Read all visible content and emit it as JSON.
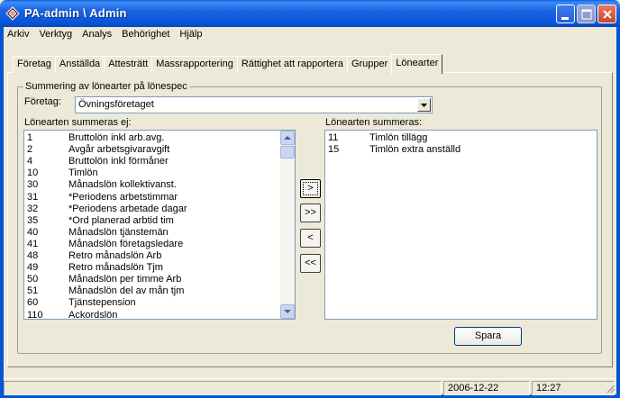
{
  "window": {
    "title": "PA-admin \\ Admin"
  },
  "menu": {
    "items": [
      "Arkiv",
      "Verktyg",
      "Analys",
      "Behörighet",
      "Hjälp"
    ]
  },
  "tabs": [
    {
      "label": "Företag",
      "active": false
    },
    {
      "label": "Anställda",
      "active": false
    },
    {
      "label": "Attesträtt",
      "active": false
    },
    {
      "label": "Massrapportering",
      "active": false
    },
    {
      "label": "Rättighet att rapportera",
      "active": false
    },
    {
      "label": "Grupper",
      "active": false
    },
    {
      "label": "Lönearter",
      "active": true
    }
  ],
  "group": {
    "title": "Summering av lönearter på lönespec",
    "company_label": "Företag:",
    "company_value": "Övningsföretaget",
    "left_label": "Lönearten summeras ej:",
    "right_label": "Lönearten summeras:"
  },
  "left_list": [
    {
      "code": "1",
      "name": "Bruttolön inkl arb.avg."
    },
    {
      "code": "2",
      "name": "Avgår arbetsgivaravgift"
    },
    {
      "code": "4",
      "name": "Bruttolön inkl förmåner"
    },
    {
      "code": "10",
      "name": "Timlön"
    },
    {
      "code": "30",
      "name": "Månadslön kollektivanst."
    },
    {
      "code": "31",
      "name": "*Periodens arbetstimmar"
    },
    {
      "code": "32",
      "name": "*Periodens arbetade dagar"
    },
    {
      "code": "35",
      "name": "*Ord planerad arbtid tim"
    },
    {
      "code": "40",
      "name": "Månadslön tjänstemän"
    },
    {
      "code": "41",
      "name": "Månadslön företagsledare"
    },
    {
      "code": "48",
      "name": "Retro månadslön Arb"
    },
    {
      "code": "49",
      "name": "Retro månadslön Tjm"
    },
    {
      "code": "50",
      "name": "Månadslön per timme Arb"
    },
    {
      "code": "51",
      "name": "Månadslön del av mån tjm"
    },
    {
      "code": "60",
      "name": "Tjänstepension"
    },
    {
      "code": "110",
      "name": "Ackordslön"
    }
  ],
  "right_list": [
    {
      "code": "11",
      "name": "Timlön tillägg"
    },
    {
      "code": "15",
      "name": "Timlön extra anställd"
    }
  ],
  "move_buttons": [
    ">",
    ">>",
    "<",
    "<<"
  ],
  "save_label": "Spara",
  "status": {
    "date": "2006-12-22",
    "time": "12:27"
  }
}
